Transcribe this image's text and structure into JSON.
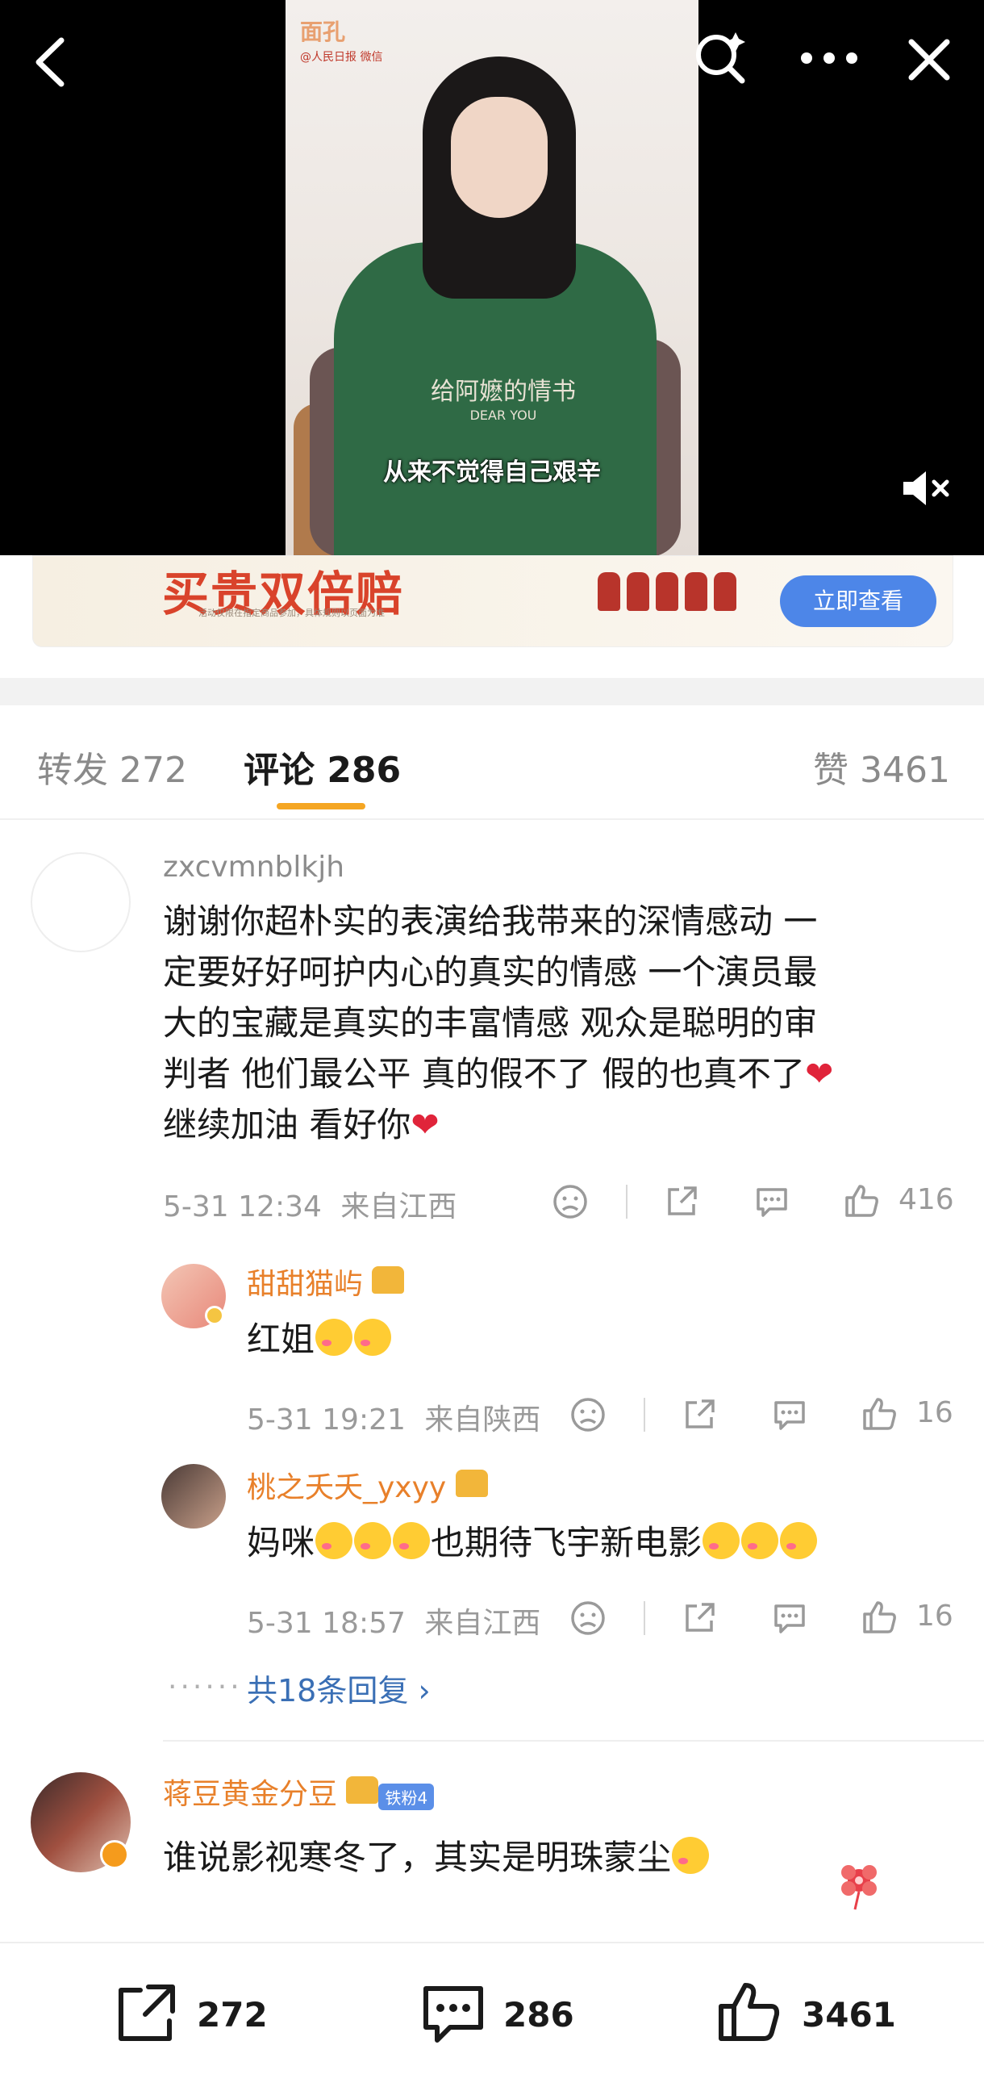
{
  "video": {
    "logo_text": "面孔",
    "logo_sub": "@人民日报 微信",
    "shirt_text": "给阿嬷的情书",
    "shirt_sub": "DEAR YOU",
    "subtitle": "从来不觉得自己艰辛",
    "back_icon": "back-icon",
    "search_icon": "search-icon",
    "more_icon": "more-icon",
    "close_icon": "close-icon",
    "mute_icon": "mute-icon"
  },
  "ad": {
    "title": "买贵双倍赔",
    "small_text": "活动仅限在指定商品参加，具体规则以页面为准",
    "button_label": "立即查看"
  },
  "tabs": {
    "repost": "转发 272",
    "comment": "评论 286",
    "like": "赞 3461"
  },
  "comments": [
    {
      "username": "zxcvmnblkjh",
      "lines": [
        "谢谢你超朴实的表演给我带来的深情感动 一",
        "定要好好呵护内心的真实的情感 一个演员最",
        "大的宝藏是真实的丰富情感   观众是聪明的审",
        "判者 他们最公平 真的假不了 假的也真不了",
        "继续加油 看好你"
      ],
      "time": "5-31 12:34",
      "location": "来自江西",
      "likes": "416",
      "replies": [
        {
          "username": "甜甜猫屿",
          "text": "红姐",
          "time": "5-31 19:21",
          "location": "来自陕西",
          "likes": "16"
        },
        {
          "username": "桃之夭夭_yxyy",
          "text_a": "妈咪",
          "text_b": "也期待飞宇新电影",
          "time": "5-31 18:57",
          "location": "来自江西",
          "likes": "16"
        }
      ],
      "more_replies": "共18条回复"
    },
    {
      "username": "蒋豆黄金分豆",
      "fan_badge": "铁粉4",
      "text": "谁说影视寒冬了，其实是明珠蒙尘"
    }
  ],
  "bottom_bar": {
    "repost_count": "272",
    "comment_count": "286",
    "like_count": "3461"
  },
  "colors": {
    "accent_orange": "#f5a623",
    "username_orange": "#e8802a",
    "ad_button": "#4d86e8"
  }
}
